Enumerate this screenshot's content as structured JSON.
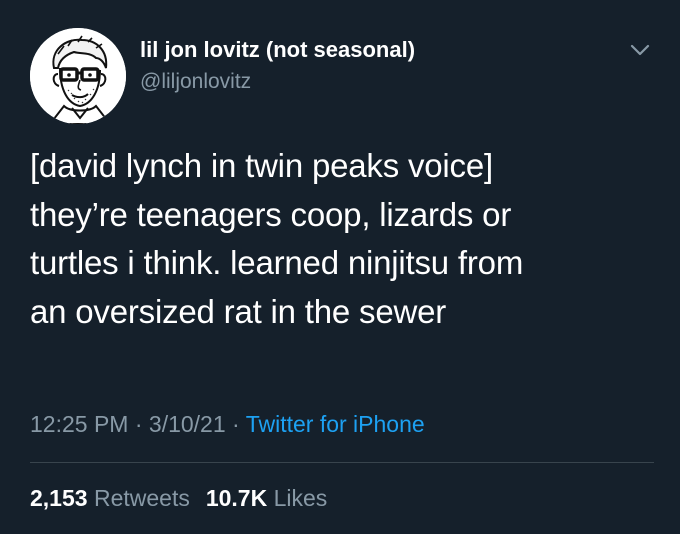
{
  "tweet": {
    "author": {
      "display_name": "lil jon lovitz (not seasonal)",
      "handle": "@liljonlovitz",
      "avatar_icon": "cartoon-portrait-avatar"
    },
    "menu_icon": "chevron-down-icon",
    "text_lines": [
      "[david lynch in twin peaks voice]",
      "they’re teenagers coop, lizards or",
      "turtles i think. learned ninjitsu from",
      "an oversized rat in the sewer"
    ],
    "time": "12:25 PM",
    "date": "3/10/21",
    "separator": "·",
    "source": "Twitter for iPhone",
    "stats": {
      "retweets_count": "2,153",
      "retweets_label": "Retweets",
      "likes_count": "10.7K",
      "likes_label": "Likes"
    }
  },
  "colors": {
    "background": "#15202b",
    "text": "#ffffff",
    "secondary": "#8899a6",
    "link": "#1da1f2",
    "divider": "#38444d"
  }
}
